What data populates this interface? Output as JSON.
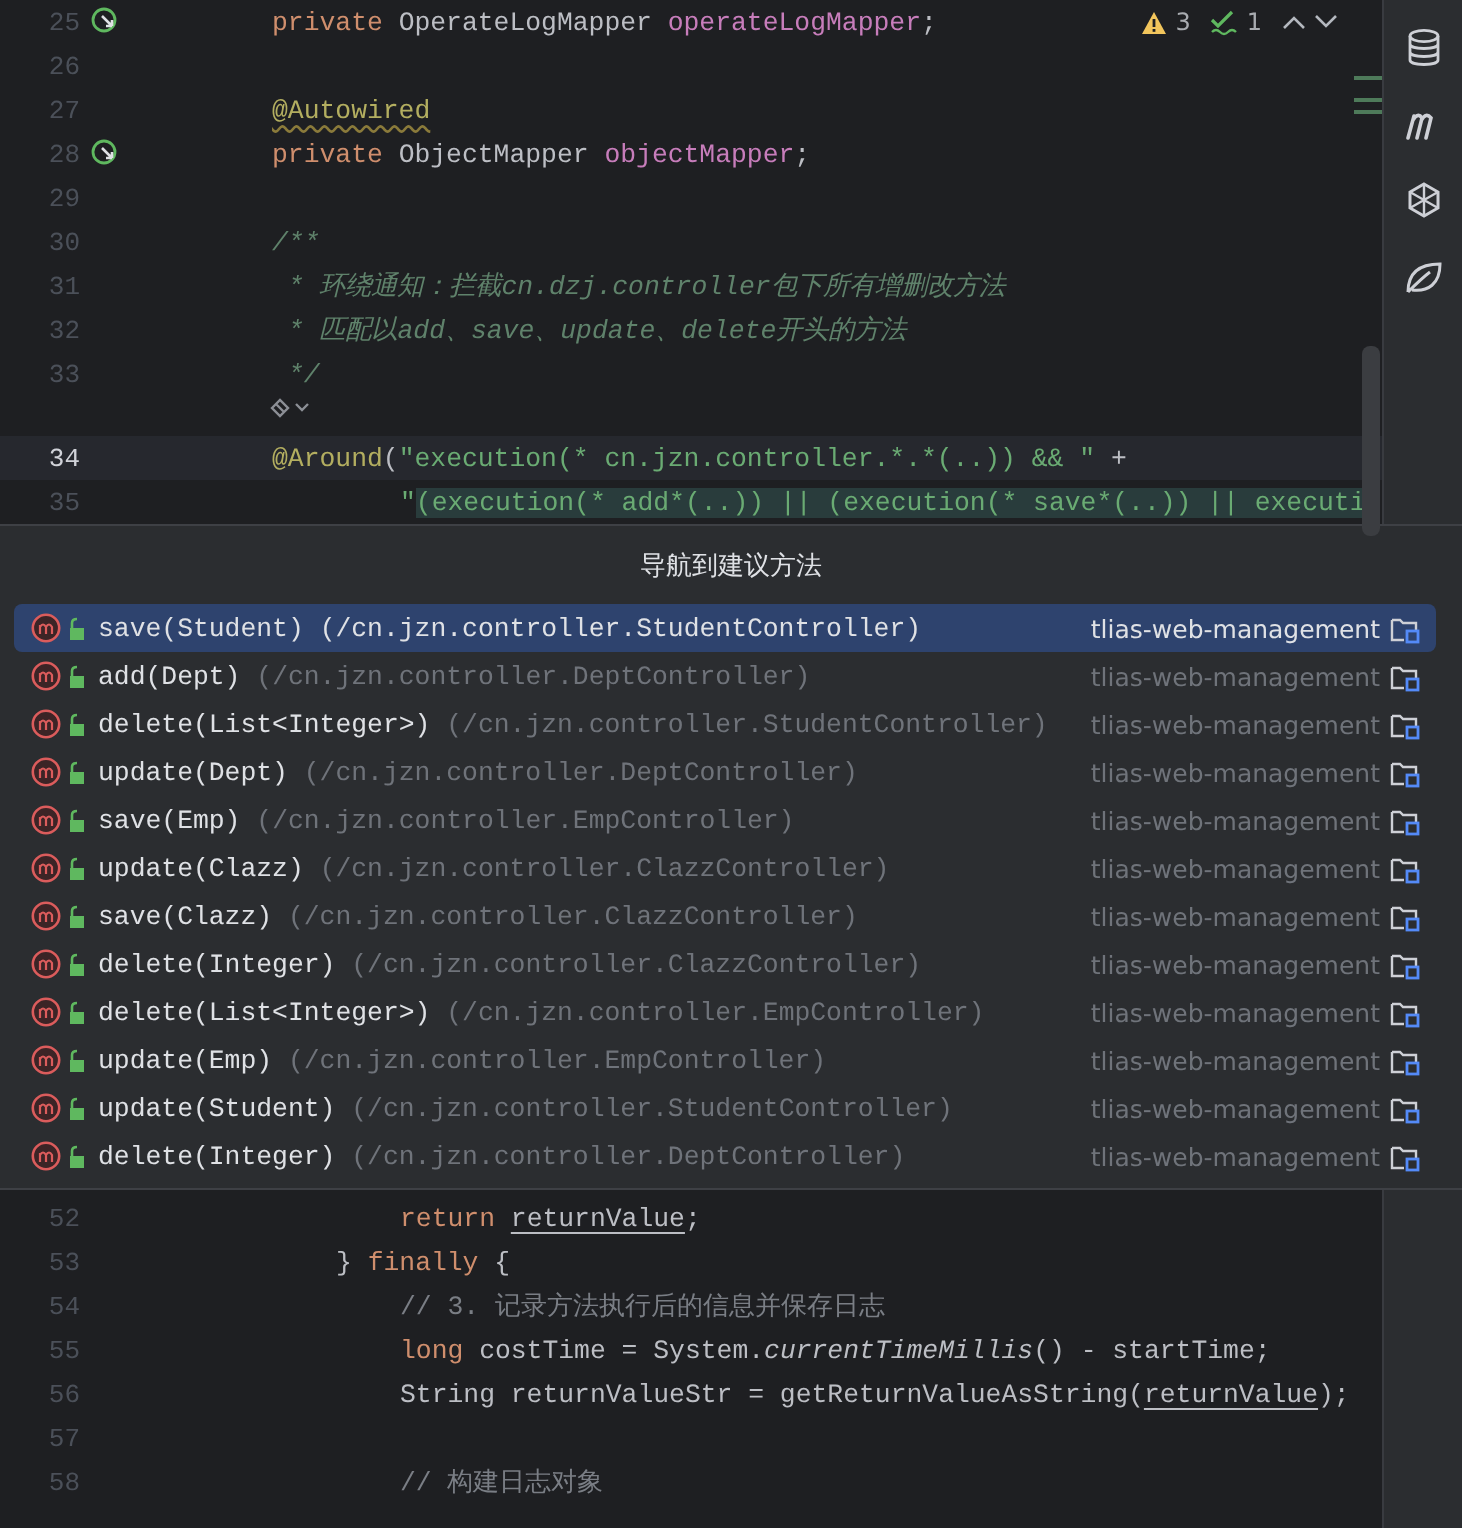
{
  "editor": {
    "top_lines": [
      {
        "kind": "code",
        "number": "25",
        "current": false,
        "gutter_icon": true,
        "tokens": [
          {
            "kind": "kw",
            "text": "private "
          },
          {
            "kind": "plain",
            "text": "OperateLogMapper "
          },
          {
            "kind": "field",
            "text": "operateLogMapper"
          },
          {
            "kind": "plain",
            "text": ";"
          }
        ]
      },
      {
        "kind": "code",
        "number": "26",
        "current": false,
        "gutter_icon": false
      },
      {
        "kind": "code",
        "number": "27",
        "current": false,
        "gutter_icon": false,
        "tokens": [
          {
            "kind": "ann-warn",
            "text": "@Autowired"
          }
        ]
      },
      {
        "kind": "code",
        "number": "28",
        "current": false,
        "gutter_icon": true,
        "tokens": [
          {
            "kind": "kw",
            "text": "private "
          },
          {
            "kind": "plain",
            "text": "ObjectMapper "
          },
          {
            "kind": "field",
            "text": "objectMapper"
          },
          {
            "kind": "plain",
            "text": ";"
          }
        ]
      },
      {
        "kind": "code",
        "number": "29",
        "current": false,
        "gutter_icon": false
      },
      {
        "kind": "code",
        "number": "30",
        "current": false,
        "gutter_icon": false,
        "tokens": [
          {
            "kind": "doc",
            "text": "/**"
          }
        ]
      },
      {
        "kind": "code",
        "number": "31",
        "current": false,
        "gutter_icon": false,
        "tokens": [
          {
            "kind": "doc",
            "text": " * 环绕通知：拦截cn.dzj.controller包下所有增删改方法"
          }
        ]
      },
      {
        "kind": "code",
        "number": "32",
        "current": false,
        "gutter_icon": false,
        "tokens": [
          {
            "kind": "doc",
            "text": " * 匹配以add、save、update、delete开头的方法"
          }
        ]
      },
      {
        "kind": "code",
        "number": "33",
        "current": false,
        "gutter_icon": false,
        "tokens": [
          {
            "kind": "doc",
            "text": " */"
          }
        ]
      },
      {
        "kind": "inlay"
      },
      {
        "kind": "code",
        "number": "34",
        "current": true,
        "gutter_icon": false,
        "tokens": [
          {
            "kind": "ann",
            "text": "@Around"
          },
          {
            "kind": "plain",
            "text": "("
          },
          {
            "kind": "str",
            "text": "\"execution(* cn.jzn.controller.*.*(..)) && \""
          },
          {
            "kind": "plain",
            "text": " +"
          }
        ]
      },
      {
        "kind": "continuation",
        "number": "35",
        "current": false,
        "gutter_icon": false,
        "tokens": [
          {
            "kind": "str",
            "text": "\""
          },
          {
            "kind": "str-hl",
            "text": "(execution(* add*(..)) || (execution(* save*(..)) || executi"
          }
        ]
      }
    ],
    "bottom_lines": [
      {
        "number": "52",
        "kind": "nested",
        "tokens": [
          {
            "kind": "kw",
            "text": "return "
          },
          {
            "kind": "local",
            "text": "returnValue"
          },
          {
            "kind": "plain",
            "text": ";"
          }
        ]
      },
      {
        "number": "53",
        "kind": "block",
        "tokens": [
          {
            "kind": "plain",
            "text": "} "
          },
          {
            "kind": "kw",
            "text": "finally"
          },
          {
            "kind": "plain",
            "text": " {"
          }
        ]
      },
      {
        "number": "54",
        "kind": "nested",
        "tokens": [
          {
            "kind": "cmt",
            "text": "// 3. 记录方法执行后的信息并保存日志"
          }
        ]
      },
      {
        "number": "55",
        "kind": "nested",
        "tokens": [
          {
            "kind": "kw",
            "text": "long"
          },
          {
            "kind": "plain",
            "text": " costTime = System."
          },
          {
            "kind": "static",
            "text": "currentTimeMillis"
          },
          {
            "kind": "plain",
            "text": "() - startTime;"
          }
        ]
      },
      {
        "number": "56",
        "kind": "nested",
        "tokens": [
          {
            "kind": "plain",
            "text": "String returnValueStr = getReturnValueAsString("
          },
          {
            "kind": "local",
            "text": "returnValue"
          },
          {
            "kind": "plain",
            "text": ");"
          }
        ]
      },
      {
        "number": "57",
        "kind": "nested"
      },
      {
        "number": "58",
        "kind": "nested",
        "tokens": [
          {
            "kind": "cmt",
            "text": "// 构建日志对象"
          }
        ]
      }
    ]
  },
  "inspection": {
    "warnings": "3",
    "checks": "1"
  },
  "popup": {
    "title": "导航到建议方法",
    "items": [
      {
        "method": "save(Student)",
        "location": "(/cn.jzn.controller.StudentController)",
        "module": "tlias-web-management",
        "selected": true
      },
      {
        "method": "add(Dept)",
        "location": "(/cn.jzn.controller.DeptController)",
        "module": "tlias-web-management",
        "selected": false
      },
      {
        "method": "delete(List<Integer>)",
        "location": "(/cn.jzn.controller.StudentController)",
        "module": "tlias-web-management",
        "selected": false
      },
      {
        "method": "update(Dept)",
        "location": "(/cn.jzn.controller.DeptController)",
        "module": "tlias-web-management",
        "selected": false
      },
      {
        "method": "save(Emp)",
        "location": "(/cn.jzn.controller.EmpController)",
        "module": "tlias-web-management",
        "selected": false
      },
      {
        "method": "update(Clazz)",
        "location": "(/cn.jzn.controller.ClazzController)",
        "module": "tlias-web-management",
        "selected": false
      },
      {
        "method": "save(Clazz)",
        "location": "(/cn.jzn.controller.ClazzController)",
        "module": "tlias-web-management",
        "selected": false
      },
      {
        "method": "delete(Integer)",
        "location": "(/cn.jzn.controller.ClazzController)",
        "module": "tlias-web-management",
        "selected": false
      },
      {
        "method": "delete(List<Integer>)",
        "location": "(/cn.jzn.controller.EmpController)",
        "module": "tlias-web-management",
        "selected": false
      },
      {
        "method": "update(Emp)",
        "location": "(/cn.jzn.controller.EmpController)",
        "module": "tlias-web-management",
        "selected": false
      },
      {
        "method": "update(Student)",
        "location": "(/cn.jzn.controller.StudentController)",
        "module": "tlias-web-management",
        "selected": false
      },
      {
        "method": "delete(Integer)",
        "location": "(/cn.jzn.controller.DeptController)",
        "module": "tlias-web-management",
        "selected": false
      }
    ]
  }
}
